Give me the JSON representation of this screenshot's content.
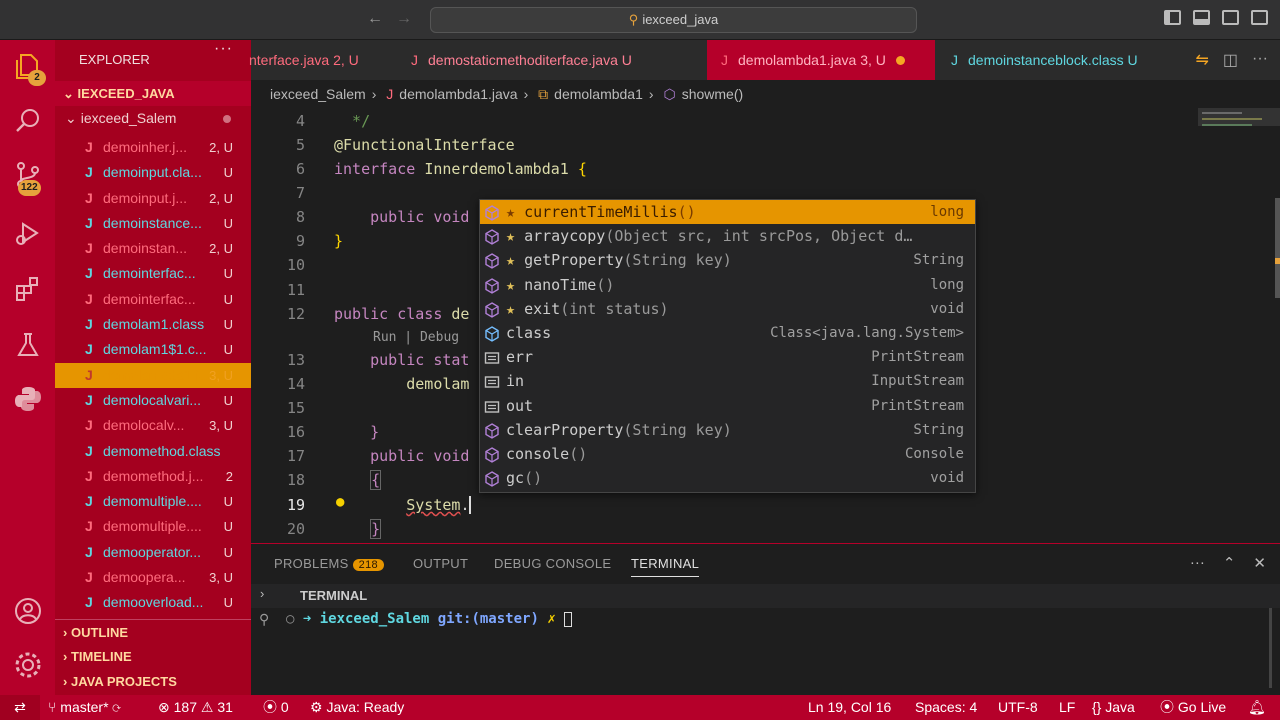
{
  "search": {
    "text": "iexceed_java"
  },
  "activity": {
    "explorer_badge": "2",
    "scm_badge": "122"
  },
  "sidebar": {
    "title": "EXPLORER",
    "workspace": "IEXCEED_JAVA",
    "project": "iexceed_Salem",
    "files": [
      {
        "icon": "J",
        "color": "red",
        "name": "demoinher.j...",
        "status": "2, U"
      },
      {
        "icon": "J",
        "color": "cyan",
        "name": "demoinput.cla...",
        "status": "U"
      },
      {
        "icon": "J",
        "color": "red",
        "name": "demoinput.j...",
        "status": "2, U"
      },
      {
        "icon": "J",
        "color": "cyan",
        "name": "demoinstance...",
        "status": "U"
      },
      {
        "icon": "J",
        "color": "red",
        "name": "demoinstan...",
        "status": "2, U"
      },
      {
        "icon": "J",
        "color": "cyan",
        "name": "demointerfac...",
        "status": "U"
      },
      {
        "icon": "J",
        "color": "red",
        "name": "demointerfac...",
        "status": "U"
      },
      {
        "icon": "J",
        "color": "cyan",
        "name": "demolam1.class",
        "status": "U"
      },
      {
        "icon": "J",
        "color": "cyan",
        "name": "demolam1$1.c...",
        "status": "U"
      },
      {
        "icon": "J",
        "color": "red",
        "name": "demolambda1.java",
        "status": "3, U"
      },
      {
        "icon": "J",
        "color": "cyan",
        "name": "demolocalvari...",
        "status": "U"
      },
      {
        "icon": "J",
        "color": "red",
        "name": "demolocalv...",
        "status": "3, U"
      },
      {
        "icon": "J",
        "color": "cyan",
        "name": "demomethod.class",
        "status": ""
      },
      {
        "icon": "J",
        "color": "red",
        "name": "demomethod.j...",
        "status": "2"
      },
      {
        "icon": "J",
        "color": "cyan",
        "name": "demomultiple....",
        "status": "U"
      },
      {
        "icon": "J",
        "color": "red",
        "name": "demomultiple....",
        "status": "U"
      },
      {
        "icon": "J",
        "color": "cyan",
        "name": "demooperator...",
        "status": "U"
      },
      {
        "icon": "J",
        "color": "red",
        "name": "demoopera...",
        "status": "3, U"
      },
      {
        "icon": "J",
        "color": "cyan",
        "name": "demooverload...",
        "status": "U"
      }
    ],
    "sections": [
      "OUTLINE",
      "TIMELINE",
      "JAVA PROJECTS"
    ]
  },
  "tabs": [
    {
      "label": "nterface.java",
      "status": "2, U",
      "icon": "J",
      "color": "red"
    },
    {
      "label": "demostaticmethoditerface.java",
      "status": "U",
      "icon": "J",
      "color": "red"
    },
    {
      "label": "demolambda1.java",
      "status": "3, U",
      "icon": "J",
      "color": "red"
    },
    {
      "label": "demoinstanceblock.class",
      "status": "U",
      "icon": "J",
      "color": "cyan"
    }
  ],
  "breadcrumb": [
    "iexceed_Salem",
    "demolambda1.java",
    "demolambda1",
    "showme()"
  ],
  "editor": {
    "line_numbers": [
      "4",
      "5",
      "6",
      "7",
      "8",
      "9",
      "10",
      "11",
      "12",
      "13",
      "14",
      "15",
      "16",
      "17",
      "18",
      "19",
      "20"
    ],
    "codelens": "Run | Debug"
  },
  "suggest": {
    "items": [
      {
        "star": true,
        "name": "currentTimeMillis",
        "args": "()",
        "type": "long",
        "kind": "method"
      },
      {
        "star": true,
        "name": "arraycopy",
        "args": "(Object src, int srcPos, Object d…",
        "type": "",
        "kind": "method"
      },
      {
        "star": true,
        "name": "getProperty",
        "args": "(String key)",
        "type": "String",
        "kind": "method"
      },
      {
        "star": true,
        "name": "nanoTime",
        "args": "()",
        "type": "long",
        "kind": "method"
      },
      {
        "star": true,
        "name": "exit",
        "args": "(int status)",
        "type": "void",
        "kind": "method"
      },
      {
        "star": false,
        "name": "class",
        "args": "",
        "type": "Class<java.lang.System>",
        "kind": "class"
      },
      {
        "star": false,
        "name": "err",
        "args": "",
        "type": "PrintStream",
        "kind": "field"
      },
      {
        "star": false,
        "name": "in",
        "args": "",
        "type": "InputStream",
        "kind": "field"
      },
      {
        "star": false,
        "name": "out",
        "args": "",
        "type": "PrintStream",
        "kind": "field"
      },
      {
        "star": false,
        "name": "clearProperty",
        "args": "(String key)",
        "type": "String",
        "kind": "method"
      },
      {
        "star": false,
        "name": "console",
        "args": "()",
        "type": "Console",
        "kind": "method"
      },
      {
        "star": false,
        "name": "gc",
        "args": "()",
        "type": "void",
        "kind": "method"
      }
    ]
  },
  "panel": {
    "tabs": [
      "PROBLEMS",
      "OUTPUT",
      "DEBUG CONSOLE",
      "TERMINAL"
    ],
    "problems_count": "218",
    "section": "TERMINAL",
    "prompt_dir": "iexceed_Salem",
    "prompt_git": "git:(master)",
    "prompt_x": "✗"
  },
  "status": {
    "branch": "master*",
    "errors": "187",
    "warnings": "31",
    "ports": "0",
    "java": "Java: Ready",
    "position": "Ln 19, Col 16",
    "spaces": "Spaces: 4",
    "encoding": "UTF-8",
    "eol": "LF",
    "lang": "Java",
    "golive": "Go Live"
  },
  "colors": {
    "accent": "#b5002a",
    "highlight": "#e69500",
    "titlebar": "#323233",
    "editor_bg": "#1e1e1e"
  }
}
